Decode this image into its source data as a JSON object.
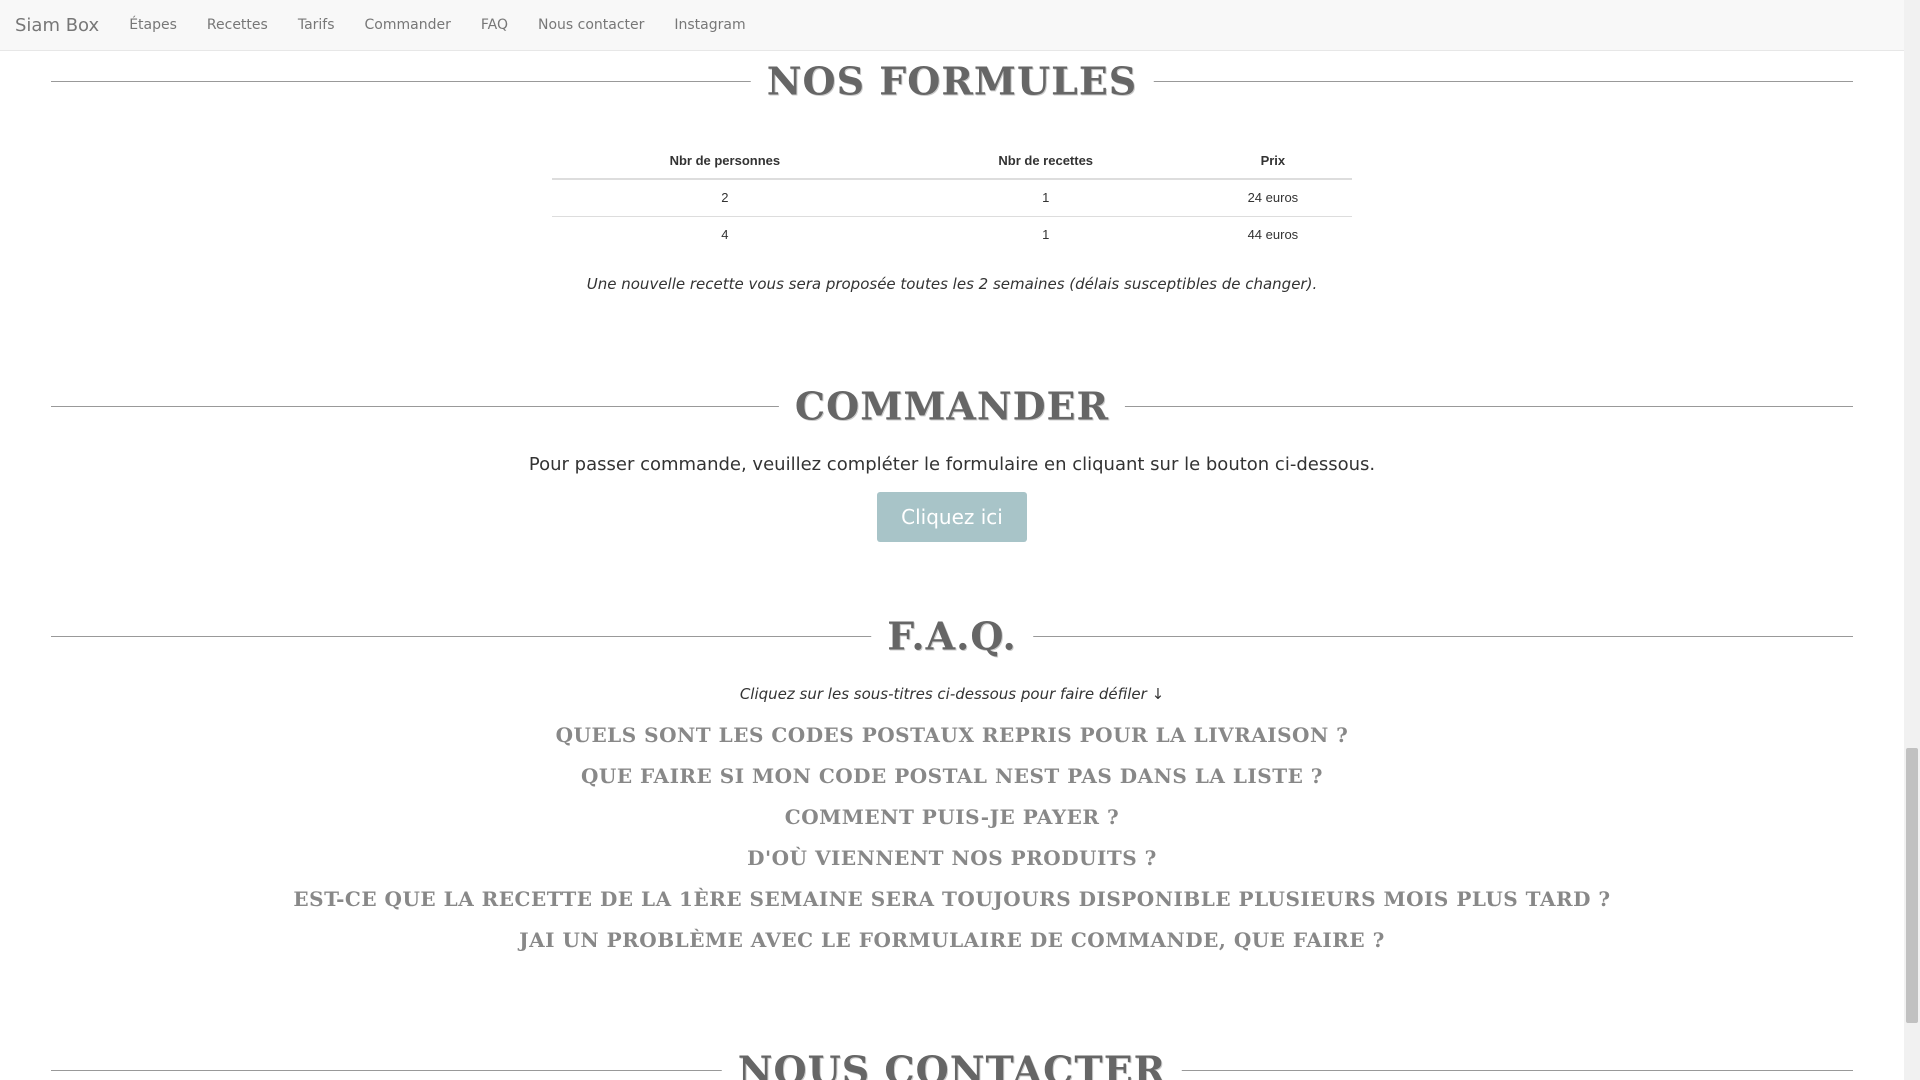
{
  "navbar": {
    "brand": "Siam Box",
    "links": [
      "Étapes",
      "Recettes",
      "Tarifs",
      "Commander",
      "FAQ",
      "Nous contacter",
      "Instagram"
    ]
  },
  "formules": {
    "title": "NOS FORMULES",
    "headers": [
      "Nbr de personnes",
      "Nbr de recettes",
      "Prix"
    ],
    "rows": [
      [
        "2",
        "1",
        "24 euros"
      ],
      [
        "4",
        "1",
        "44 euros"
      ]
    ],
    "note": "Une nouvelle recette vous sera proposée toutes les 2 semaines (délais susceptibles de changer)."
  },
  "commander": {
    "title": "COMMANDER",
    "text": "Pour passer commande, veuillez compléter le formulaire en cliquant sur le bouton ci-dessous.",
    "button_label": "Cliquez ici"
  },
  "faq": {
    "title": "F.A.Q.",
    "hint": "Cliquez sur les sous-titres ci-dessous pour faire défiler ↓",
    "questions": [
      "QUELS SONT LES CODES POSTAUX REPRIS POUR LA LIVRAISON ?",
      "QUE FAIRE SI MON CODE POSTAL NEST PAS DANS LA LISTE ?",
      "COMMENT PUIS-JE PAYER ?",
      "D'OÙ VIENNENT NOS PRODUITS ?",
      "EST-CE QUE LA RECETTE DE LA 1ÈRE SEMAINE SERA TOUJOURS DISPONIBLE PLUSIEURS MOIS PLUS TARD ?",
      "JAI UN PROBLÈME AVEC LE FORMULAIRE DE COMMANDE, QUE FAIRE ?"
    ]
  },
  "contact": {
    "title": "NOUS CONTACTER"
  },
  "colors": {
    "button_bg": "#a8c4c8",
    "navbar_bg": "#f8f8f8"
  }
}
